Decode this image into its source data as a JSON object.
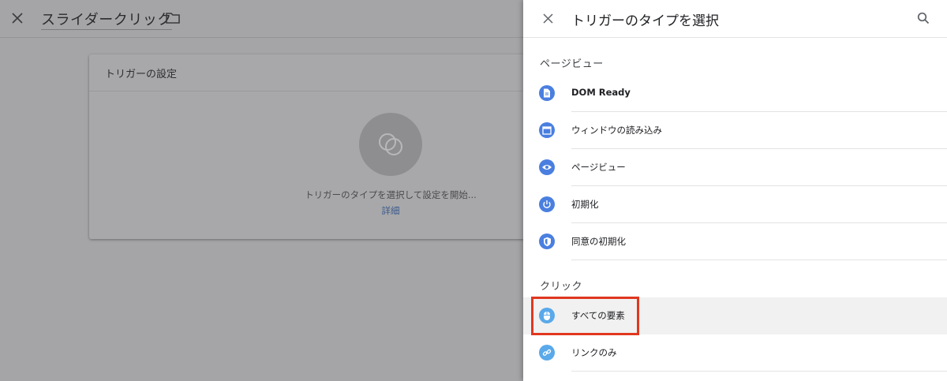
{
  "editor": {
    "title": "スライダークリック"
  },
  "trigger_card": {
    "title": "トリガーの設定",
    "hint": "トリガーのタイプを選択して設定を開始...",
    "learn_more": "詳細"
  },
  "panel": {
    "title": "トリガーのタイプを選択",
    "sections": [
      {
        "title": "ページビュー",
        "items": [
          {
            "label": "DOM Ready",
            "icon": "document-icon"
          },
          {
            "label": "ウィンドウの読み込み",
            "icon": "window-icon"
          },
          {
            "label": "ページビュー",
            "icon": "eye-icon"
          },
          {
            "label": "初期化",
            "icon": "power-icon"
          },
          {
            "label": "同意の初期化",
            "icon": "shield-icon"
          }
        ]
      },
      {
        "title": "クリック",
        "items": [
          {
            "label": "すべての要素",
            "icon": "mouse-icon"
          },
          {
            "label": "リンクのみ",
            "icon": "link-icon"
          }
        ]
      }
    ]
  },
  "colors": {
    "icon_blue": "#4a7fe0",
    "icon_light_blue": "#5aa9ea",
    "highlight_red": "#e0371f",
    "overlay_gray": "#a5a5a7"
  }
}
